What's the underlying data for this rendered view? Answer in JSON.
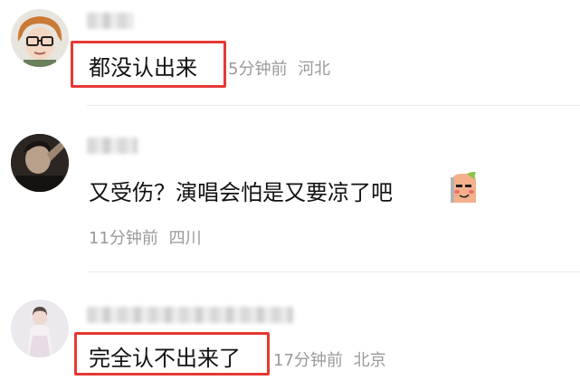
{
  "comments": [
    {
      "text": "都没认出来",
      "time": "5分钟前",
      "location": "河北"
    },
    {
      "text": "又受伤？演唱会怕是又要凉了吧",
      "time": "11分钟前",
      "location": "四川",
      "emoji": "smirk-emoji-icon"
    },
    {
      "text": "完全认不出来了",
      "time": "17分钟前",
      "location": "北京"
    }
  ],
  "colors": {
    "highlight": "#e53935",
    "meta_text": "#9a9a9a",
    "body_text": "#111111"
  }
}
